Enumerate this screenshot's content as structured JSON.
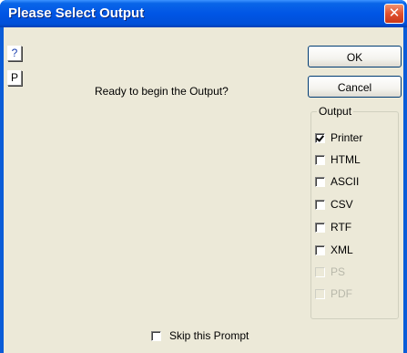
{
  "window": {
    "title": "Please Select Output",
    "close_glyph": "✕"
  },
  "side_buttons": {
    "help_label": "?",
    "print_label": "P"
  },
  "prompt": "Ready to begin the Output?",
  "buttons": {
    "ok_label": "OK",
    "cancel_label": "Cancel"
  },
  "output_group": {
    "label": "Output",
    "options": [
      {
        "label": "Printer",
        "checked": true,
        "enabled": true
      },
      {
        "label": "HTML",
        "checked": false,
        "enabled": true
      },
      {
        "label": "ASCII",
        "checked": false,
        "enabled": true
      },
      {
        "label": "CSV",
        "checked": false,
        "enabled": true
      },
      {
        "label": "RTF",
        "checked": false,
        "enabled": true
      },
      {
        "label": "XML",
        "checked": false,
        "enabled": true
      },
      {
        "label": "PS",
        "checked": false,
        "enabled": false
      },
      {
        "label": "PDF",
        "checked": false,
        "enabled": false
      }
    ]
  },
  "skip_prompt": {
    "label": "Skip this Prompt",
    "checked": false
  },
  "colors": {
    "titlebar": "#0055e5",
    "face": "#ece9d8",
    "close": "#e0512f",
    "disabled_text": "#b8b8aa"
  },
  "icons": {
    "close": "close-icon",
    "check": "check-icon"
  }
}
